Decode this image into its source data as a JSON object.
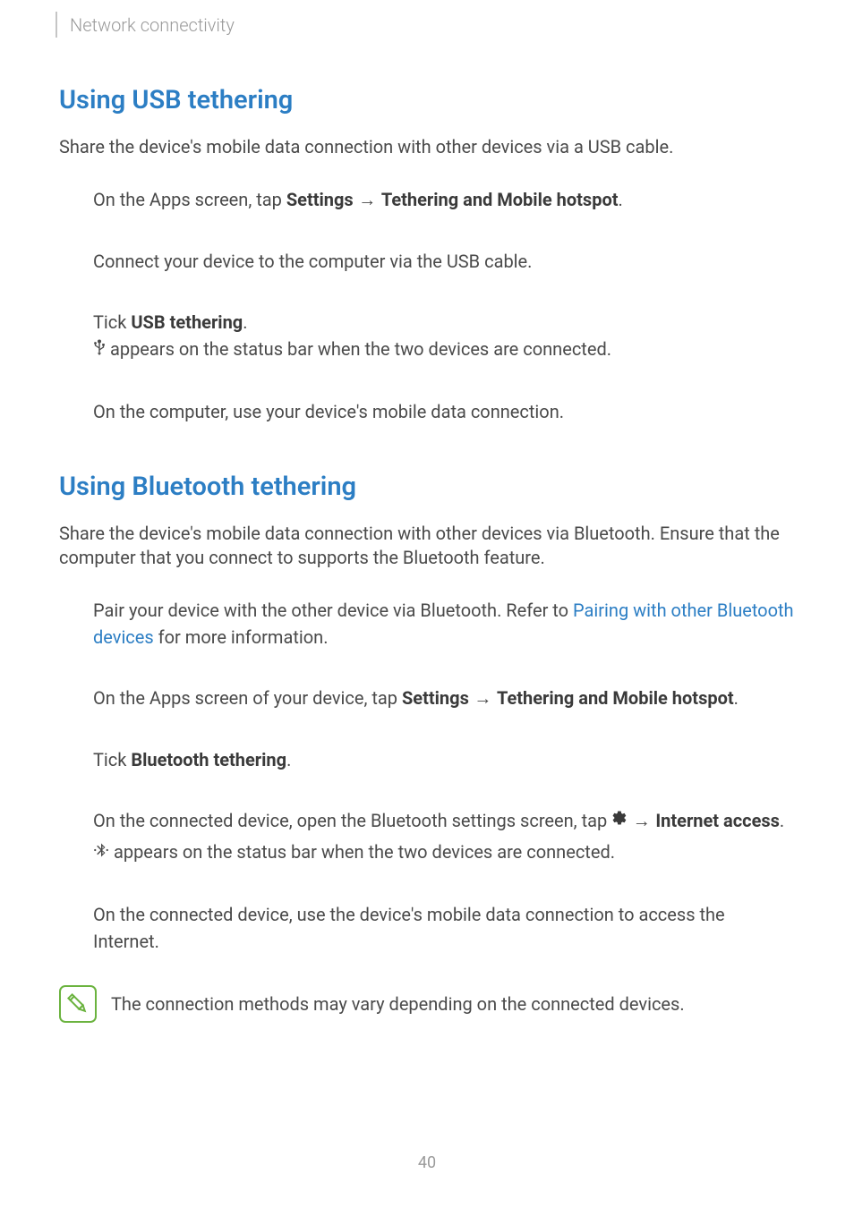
{
  "header": {
    "breadcrumb": "Network connectivity"
  },
  "section_usb": {
    "heading": "Using USB tethering",
    "intro": "Share the device's mobile data connection with other devices via a USB cable.",
    "step1_pre": "On the Apps screen, tap ",
    "step1_b1": "Settings",
    "step1_arrow": " → ",
    "step1_b2": "Tethering and Mobile hotspot",
    "step1_post": ".",
    "step2": "Connect your device to the computer via the USB cable.",
    "step3_pre": "Tick ",
    "step3_b": "USB tethering",
    "step3_post": ".",
    "step3_line2_post": " appears on the status bar when the two devices are connected.",
    "step4": "On the computer, use your device's mobile data connection."
  },
  "section_bt": {
    "heading": "Using Bluetooth tethering",
    "intro": "Share the device's mobile data connection with other devices via Bluetooth. Ensure that the computer that you connect to supports the Bluetooth feature.",
    "step1_pre": "Pair your device with the other device via Bluetooth. Refer to ",
    "step1_link": "Pairing with other Bluetooth devices",
    "step1_post": " for more information.",
    "step2_pre": "On the Apps screen of your device, tap ",
    "step2_b1": "Settings",
    "step2_arrow": " → ",
    "step2_b2": "Tethering and Mobile hotspot",
    "step2_post": ".",
    "step3_pre": "Tick ",
    "step3_b": "Bluetooth tethering",
    "step3_post": ".",
    "step4_pre": "On the connected device, open the Bluetooth settings screen, tap ",
    "step4_arrow": " → ",
    "step4_b": "Internet access",
    "step4_post": ".",
    "step4_line2_post": " appears on the status bar when the two devices are connected.",
    "step5": "On the connected device, use the device's mobile data connection to access the Internet."
  },
  "note": {
    "text": "The connection methods may vary depending on the connected devices."
  },
  "page_number": "40"
}
